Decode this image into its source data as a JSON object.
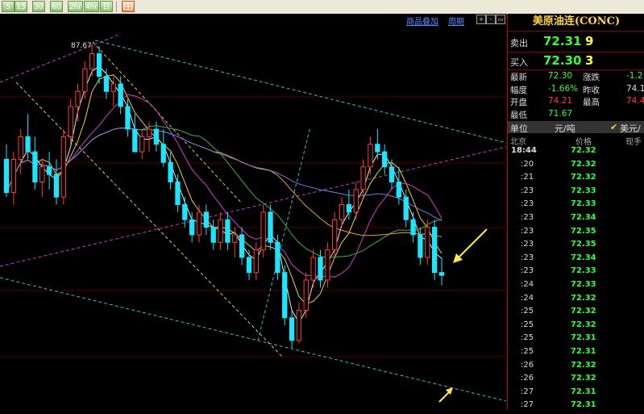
{
  "toolbar": {
    "buttons": [
      "5",
      "15",
      "30",
      "60",
      "2hr",
      "4hr",
      "日"
    ],
    "extra_button_icon": "grid-icon"
  },
  "chart_header": {
    "overlay_link": "商品叠加",
    "period_link": "周期"
  },
  "chart_data": {
    "type": "candlestick",
    "peak_label": "87.67",
    "colors": {
      "up": "#ff3b3b",
      "down": "#19e6ff",
      "ma_white": "#e6e6e6",
      "ma_yellow": "#e6d23c",
      "ma_magenta": "#d23cd2",
      "ma_green": "#3cb43c",
      "ma_orange": "#e6a032",
      "ma_purple": "#7878e6",
      "trend_magenta": "#c040c0",
      "trend_cyan": "#30c0c0",
      "trend_yellow": "#d0d040"
    },
    "candles": [
      [
        80.0,
        81.0,
        77.5,
        77.8
      ],
      [
        77.8,
        80.5,
        77.0,
        80.0
      ],
      [
        80.0,
        82.0,
        79.0,
        81.5
      ],
      [
        81.5,
        83.0,
        80.0,
        80.5
      ],
      [
        80.5,
        81.5,
        78.0,
        78.5
      ],
      [
        78.5,
        80.0,
        77.5,
        79.5
      ],
      [
        79.5,
        80.5,
        78.0,
        79.0
      ],
      [
        79.0,
        80.0,
        77.0,
        77.5
      ],
      [
        77.5,
        82.0,
        77.0,
        81.5
      ],
      [
        81.5,
        84.0,
        81.0,
        83.5
      ],
      [
        83.5,
        85.0,
        82.5,
        84.5
      ],
      [
        84.5,
        86.5,
        84.0,
        86.0
      ],
      [
        86.0,
        87.67,
        85.5,
        87.0
      ],
      [
        87.0,
        87.5,
        85.0,
        85.5
      ],
      [
        85.5,
        86.0,
        84.0,
        84.5
      ],
      [
        84.5,
        85.5,
        83.5,
        85.0
      ],
      [
        85.0,
        85.5,
        83.0,
        83.5
      ],
      [
        83.5,
        84.0,
        81.5,
        82.0
      ],
      [
        82.0,
        83.0,
        80.5,
        80.5
      ],
      [
        80.5,
        82.0,
        80.0,
        81.5
      ],
      [
        81.5,
        82.5,
        80.5,
        82.0
      ],
      [
        82.0,
        82.5,
        80.5,
        81.0
      ],
      [
        81.0,
        82.0,
        79.5,
        79.8
      ],
      [
        79.8,
        80.5,
        78.0,
        78.5
      ],
      [
        78.5,
        79.0,
        76.5,
        77.0
      ],
      [
        77.0,
        77.5,
        75.5,
        76.0
      ],
      [
        76.0,
        76.5,
        74.5,
        75.0
      ],
      [
        75.0,
        77.0,
        74.5,
        76.5
      ],
      [
        76.5,
        77.0,
        75.0,
        75.5
      ],
      [
        75.5,
        76.0,
        74.0,
        74.5
      ],
      [
        74.5,
        76.5,
        74.0,
        76.0
      ],
      [
        76.0,
        76.5,
        74.0,
        74.5
      ],
      [
        74.5,
        75.5,
        73.5,
        75.0
      ],
      [
        75.0,
        75.5,
        73.0,
        73.5
      ],
      [
        73.5,
        74.0,
        72.0,
        72.5
      ],
      [
        72.5,
        74.5,
        72.0,
        74.0
      ],
      [
        74.0,
        77.0,
        73.5,
        76.5
      ],
      [
        76.5,
        77.0,
        74.0,
        74.5
      ],
      [
        74.5,
        75.0,
        72.0,
        72.5
      ],
      [
        72.5,
        73.0,
        69.0,
        69.5
      ],
      [
        69.5,
        70.0,
        67.5,
        68.0
      ],
      [
        68.0,
        70.5,
        67.8,
        70.0
      ],
      [
        70.0,
        72.5,
        69.5,
        72.0
      ],
      [
        72.0,
        74.0,
        71.5,
        73.5
      ],
      [
        73.5,
        74.0,
        71.5,
        72.0
      ],
      [
        72.0,
        74.5,
        71.5,
        74.0
      ],
      [
        74.0,
        76.5,
        73.5,
        76.0
      ],
      [
        76.0,
        77.5,
        75.5,
        77.0
      ],
      [
        77.0,
        78.0,
        76.0,
        76.5
      ],
      [
        76.5,
        78.5,
        76.0,
        78.0
      ],
      [
        78.0,
        80.0,
        77.5,
        79.5
      ],
      [
        79.5,
        81.5,
        79.0,
        81.0
      ],
      [
        81.0,
        82.0,
        80.0,
        80.5
      ],
      [
        80.5,
        81.0,
        79.0,
        79.5
      ],
      [
        79.5,
        80.0,
        78.0,
        78.5
      ],
      [
        78.5,
        79.5,
        77.0,
        77.5
      ],
      [
        77.5,
        78.0,
        75.5,
        76.0
      ],
      [
        76.0,
        76.5,
        74.5,
        75.0
      ],
      [
        75.0,
        75.5,
        73.0,
        73.5
      ],
      [
        73.5,
        76.0,
        73.0,
        75.5
      ],
      [
        75.5,
        76.0,
        72.0,
        72.5
      ],
      [
        72.5,
        73.5,
        71.67,
        72.31
      ]
    ]
  },
  "side": {
    "title": "美原油连(CONC)",
    "ask_label": "卖出",
    "ask_price": "72.31",
    "ask_vol": "9",
    "bid_label": "买入",
    "bid_price": "72.30",
    "bid_vol": "3",
    "stats": [
      {
        "l1": "最新",
        "v1": "72.30",
        "c1": "g",
        "l2": "涨跌",
        "v2": "-1.2",
        "c2": "g"
      },
      {
        "l1": "幅度",
        "v1": "-1.66%",
        "c1": "g",
        "l2": "昨收",
        "v2": "74.1",
        "c2": "w"
      },
      {
        "l1": "开盘",
        "v1": "74.21",
        "c1": "r",
        "l2": "最高",
        "v2": "74.4",
        "c2": "r"
      },
      {
        "l1": "最低",
        "v1": "71.67",
        "c1": "g",
        "l2": "",
        "v2": "",
        "c2": "w"
      }
    ],
    "unit_label": "单位",
    "unit_value": "元/吨",
    "unit_alt": "美元/"
  },
  "ticks": {
    "headers": [
      "北京",
      "价格",
      "现手"
    ],
    "rows": [
      {
        "time": "18:44",
        "price": "72.32"
      },
      {
        "time": ":20",
        "price": "72.32"
      },
      {
        "time": ":21",
        "price": "72.32"
      },
      {
        "time": ":23",
        "price": "72.33"
      },
      {
        "time": ":23",
        "price": "72.33"
      },
      {
        "time": ":23",
        "price": "72.34"
      },
      {
        "time": ":23",
        "price": "72.35"
      },
      {
        "time": ":23",
        "price": "72.35"
      },
      {
        "time": ":23",
        "price": "72.34"
      },
      {
        "time": ":23",
        "price": "72.33"
      },
      {
        "time": ":24",
        "price": "72.33"
      },
      {
        "time": ":24",
        "price": "72.32"
      },
      {
        "time": ":25",
        "price": "72.32"
      },
      {
        "time": ":25",
        "price": "72.32"
      },
      {
        "time": ":25",
        "price": "72.31"
      },
      {
        "time": ":25",
        "price": "72.31"
      },
      {
        "time": ":26",
        "price": "72.32"
      },
      {
        "time": ":26",
        "price": "72.32"
      },
      {
        "time": ":27",
        "price": "72.31"
      },
      {
        "time": ":27",
        "price": "72.31"
      }
    ]
  }
}
